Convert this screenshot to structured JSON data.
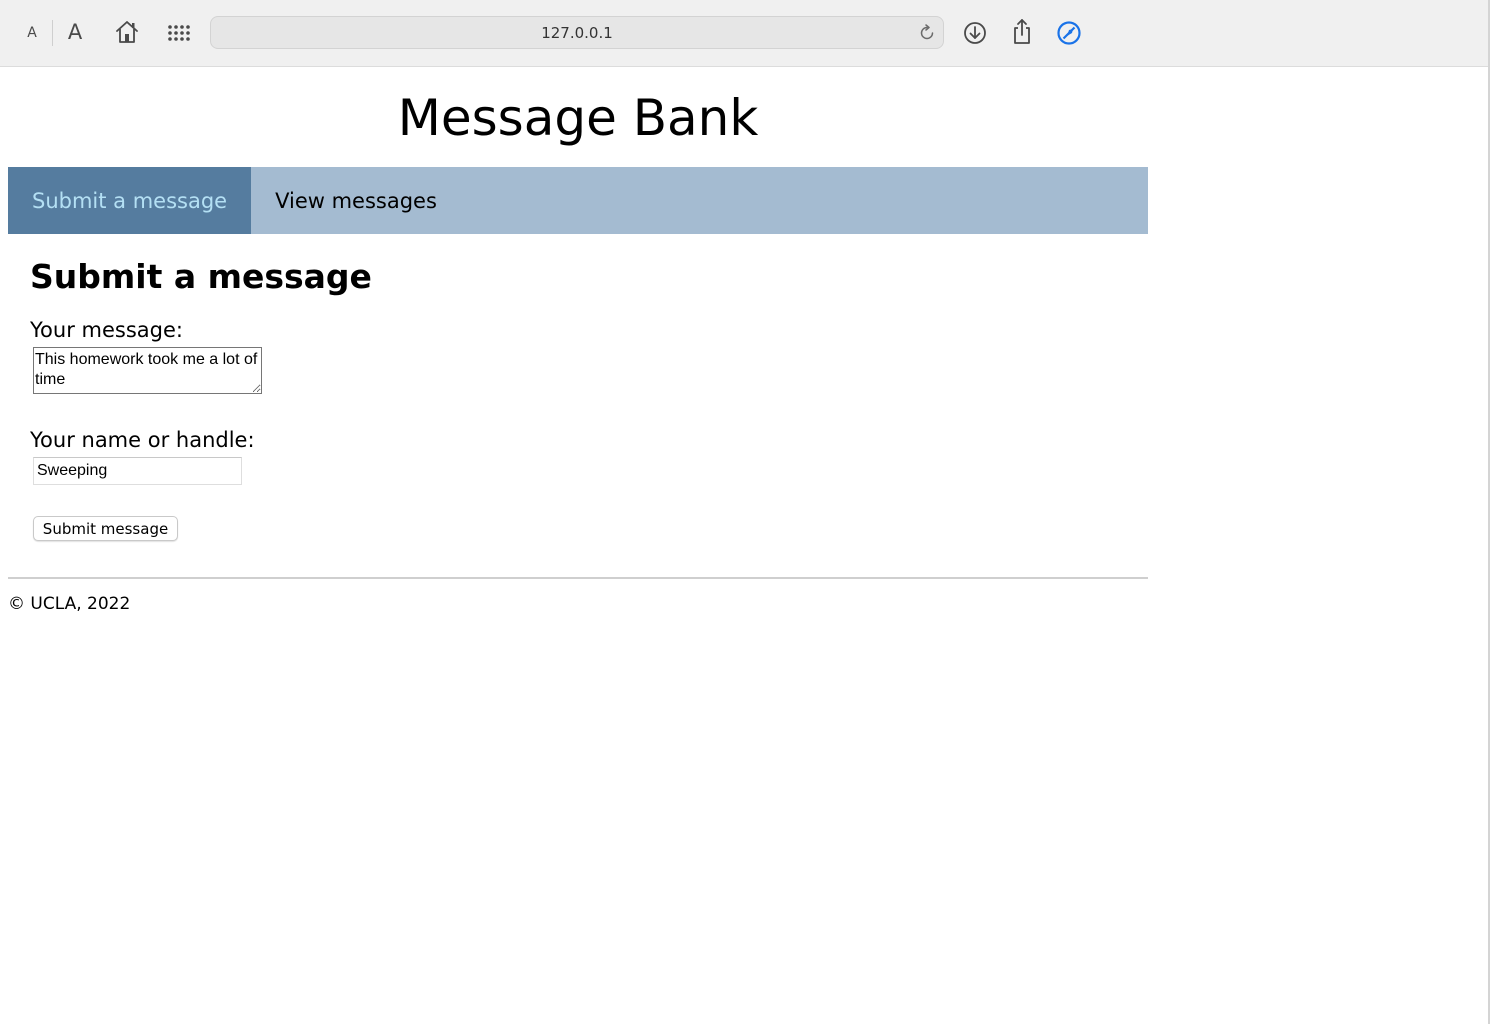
{
  "browser": {
    "font_small_label": "A",
    "font_large_label": "A",
    "address": "127.0.0.1",
    "icons": [
      "home-icon",
      "grid-icon",
      "reload-icon",
      "download-icon",
      "share-icon",
      "blocker-icon"
    ],
    "accent_color": "#1a73e8"
  },
  "page": {
    "title": "Message Bank",
    "nav": {
      "items": [
        {
          "label": "Submit a message",
          "active": true
        },
        {
          "label": "View messages",
          "active": false
        }
      ],
      "bar_color": "#a4bbd1",
      "active_color": "#557c9f",
      "active_text_color": "#b4e0f4"
    },
    "form": {
      "heading": "Submit a message",
      "message_label": "Your message:",
      "message_value": "This homework took me a lot of time",
      "name_label": "Your name or handle:",
      "name_value": "Sweeping",
      "submit_label": "Submit message"
    },
    "footer": {
      "text": "© UCLA, 2022"
    }
  }
}
